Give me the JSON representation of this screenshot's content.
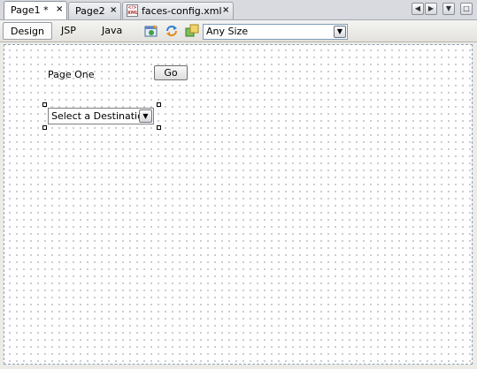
{
  "doc_tabs": [
    {
      "label": "Page1 *",
      "close": "×"
    },
    {
      "label": "Page2",
      "close": "×"
    },
    {
      "label": "faces-config.xml",
      "close": "×"
    }
  ],
  "window_controls": {
    "left_arrow": "◀",
    "right_arrow": "▶",
    "dropdown": "▼",
    "maximize": "□"
  },
  "view_tabs": [
    {
      "label": "Design",
      "active": true
    },
    {
      "label": "JSP",
      "active": false
    },
    {
      "label": "Java",
      "active": false
    }
  ],
  "toolbar_icons": [
    "preview-in-browser-icon",
    "refresh-icon",
    "show-virtual-forms-icon"
  ],
  "size_combo": {
    "value": "Any Size",
    "arrow": "▼"
  },
  "canvas": {
    "static_text": "Page One",
    "go_button": "Go",
    "dropdown": {
      "value": "Select a Destination",
      "arrow": "▼"
    }
  },
  "colors": {
    "canvas_bg": "#ffffff",
    "grid_dot": "#b9bcc4",
    "frame": "#ecebe6"
  }
}
